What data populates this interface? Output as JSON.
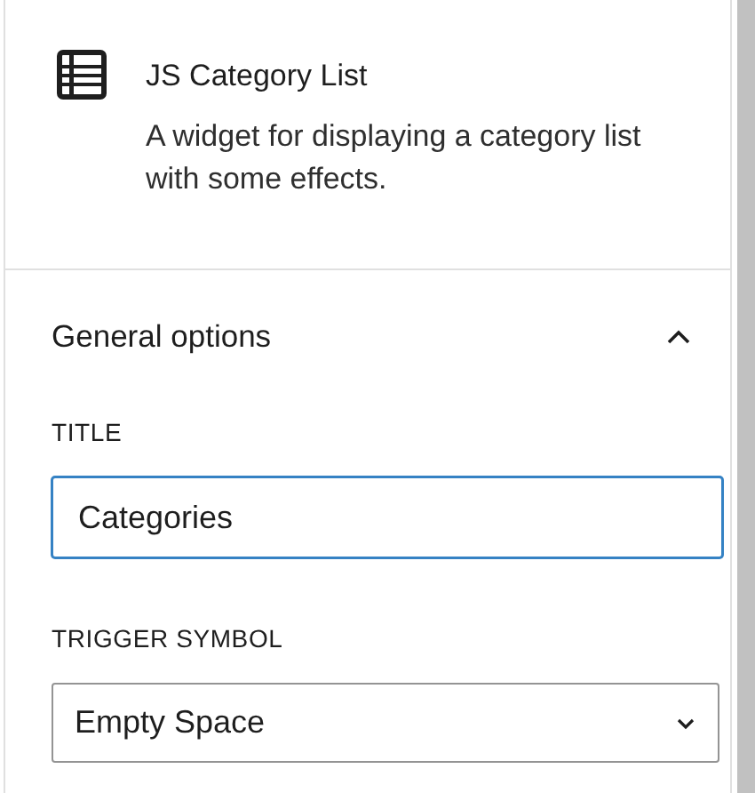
{
  "block": {
    "title": "JS Category List",
    "description": "A widget for displaying a category list with some effects."
  },
  "panel": {
    "title": "General options",
    "expanded": true
  },
  "fields": [
    {
      "kind": "text",
      "label": "TITLE",
      "value": "Categories",
      "focused": true
    },
    {
      "kind": "select",
      "label": "TRIGGER SYMBOL",
      "value": "Empty Space",
      "focused": false
    }
  ]
}
